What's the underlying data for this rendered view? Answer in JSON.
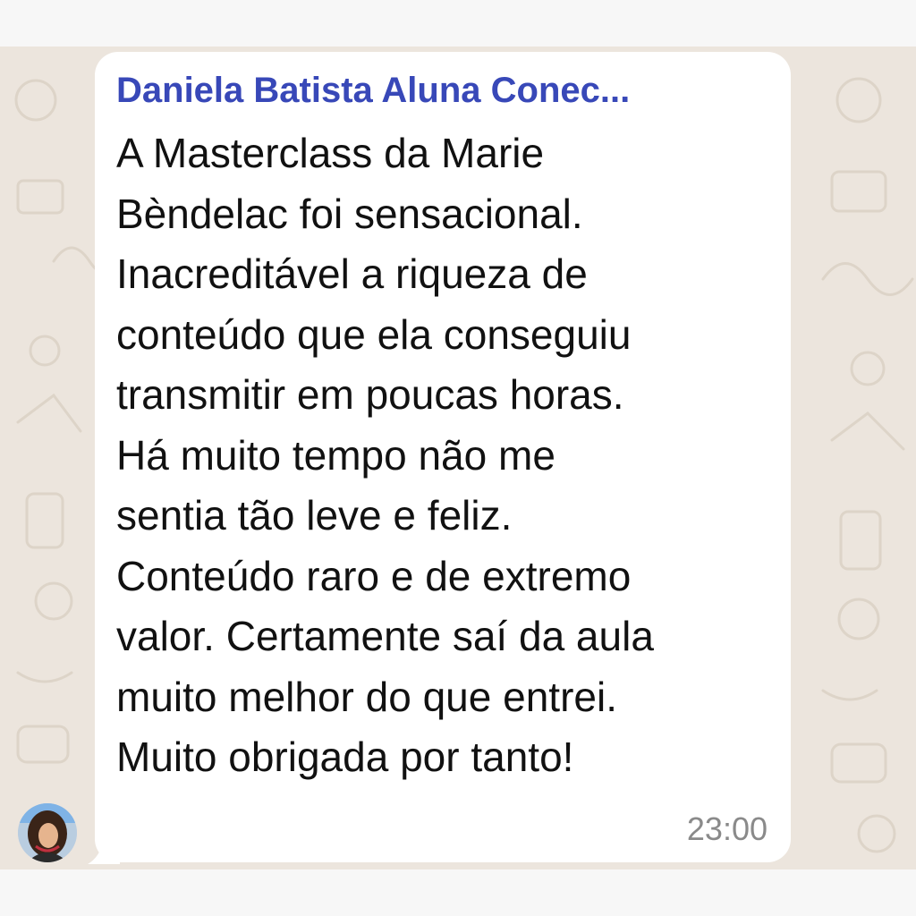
{
  "chat": {
    "sender_name": "Daniela Batista Aluna Conec...",
    "message_lines": [
      "A Masterclass da Marie",
      "Bèndelac foi sensacional.",
      "Inacreditável a riqueza de",
      "conteúdo que ela conseguiu",
      "transmitir em poucas horas.",
      "Há muito tempo não me",
      "sentia tão leve e feliz.",
      "Conteúdo raro e de extremo",
      "valor. Certamente saí da aula",
      "muito melhor do que entrei.",
      "Muito obrigada por tanto!"
    ],
    "timestamp": "23:00"
  },
  "colors": {
    "sender_name": "#3848b8",
    "chat_background": "#ece5dd",
    "bubble": "#ffffff",
    "timestamp": "#8a8a8a"
  },
  "icons": {
    "avatar": "sender-avatar-photo"
  }
}
